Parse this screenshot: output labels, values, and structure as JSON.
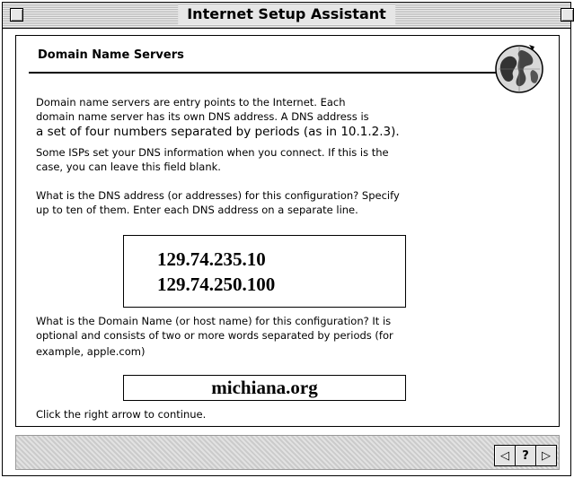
{
  "window": {
    "title": "Internet Setup Assistant"
  },
  "section": {
    "title": "Domain Name Servers"
  },
  "intro": {
    "line1": "Domain name servers are entry points to the Internet.  Each",
    "line2": "domain name server has its own DNS address. A DNS address is",
    "line3": "a set of four numbers separated by periods (as in 10.1.2.3)."
  },
  "isp_note": {
    "line1": "Some ISPs set your DNS information when you connect.  If this is the",
    "line2": "case, you can leave this field blank."
  },
  "dns_prompt": {
    "line1": "What is the DNS address (or addresses) for this configuration?  Specify",
    "line2": "up to ten of them.  Enter each DNS address on a separate line."
  },
  "dns_field": {
    "values": [
      "129.74.235.10",
      "129.74.250.100"
    ]
  },
  "domain_prompt": {
    "line1": "What is the Domain Name (or host name) for this configuration?  It is",
    "line2": "optional and consists of two or more words separated by periods (for",
    "line3": "example, apple.com)"
  },
  "domain_field": {
    "value": "michiana.org"
  },
  "continue_text": "Click the right arrow to continue.",
  "nav": {
    "back_glyph": "◁",
    "help_label": "?",
    "forward_glyph": "▷"
  },
  "icons": {
    "globe": "globe-icon"
  }
}
